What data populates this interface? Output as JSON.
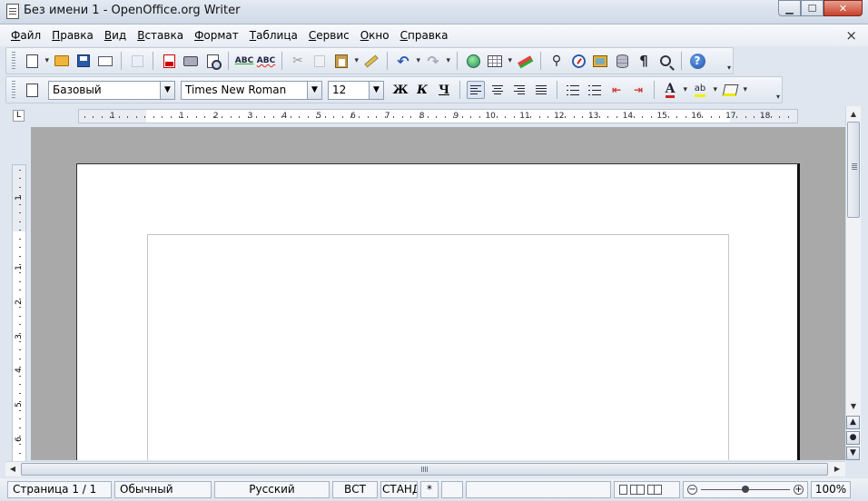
{
  "window": {
    "title": "Без имени 1 - OpenOffice.org Writer",
    "min_label": "▁",
    "max_label": "☐",
    "close_label": "✕"
  },
  "menubar": {
    "items": [
      "Файл",
      "Правка",
      "Вид",
      "Вставка",
      "Формат",
      "Таблица",
      "Сервис",
      "Окно",
      "Справка"
    ],
    "doc_close": "×"
  },
  "formatting": {
    "style": "Базовый",
    "font": "Times New Roman",
    "size": "12",
    "bold": "Ж",
    "italic": "К",
    "underline": "Ч",
    "undo_glyph": "↶",
    "redo_glyph": "↷",
    "cut_glyph": "✂",
    "find_glyph": "⚲",
    "pilcrow": "¶",
    "help": "?",
    "indent_dec": "⇤",
    "indent_inc": "⇥",
    "font_color_glyph": "A",
    "highlight_glyph": "ab"
  },
  "ruler": {
    "corner": "L",
    "h_labels": [
      "1",
      "1",
      "2",
      "3",
      "4",
      "5",
      "6",
      "7",
      "8",
      "9",
      "10",
      "11",
      "12",
      "13",
      "14",
      "15",
      "16",
      "17",
      "18"
    ],
    "v_labels": [
      "1",
      "1",
      "2",
      "3",
      "4",
      "5",
      "6"
    ]
  },
  "scroll": {
    "up": "▲",
    "down": "▼",
    "left": "◀",
    "right": "▶",
    "prev": "▲",
    "nav": "●",
    "next": "▼"
  },
  "statusbar": {
    "page": "Страница  1 / 1",
    "page_style": "Обычный",
    "language": "Русский",
    "insert_mode": "ВСТ",
    "selection_mode": "СТАНД",
    "modified": "*",
    "zoom_out": "−",
    "zoom_in": "+",
    "zoom": "100%"
  },
  "icons": [
    "new-document-icon",
    "open-folder-icon",
    "save-icon",
    "email-icon",
    "edit-file-icon",
    "export-pdf-icon",
    "print-icon",
    "print-preview-icon",
    "spellcheck-icon",
    "autospellcheck-icon",
    "cut-icon",
    "copy-icon",
    "paste-icon",
    "clone-formatting-icon",
    "undo-icon",
    "redo-icon",
    "hyperlink-icon",
    "table-icon",
    "draw-functions-icon",
    "find-replace-icon",
    "navigator-icon",
    "gallery-icon",
    "data-sources-icon",
    "formatting-marks-icon",
    "zoom-icon",
    "help-icon"
  ]
}
